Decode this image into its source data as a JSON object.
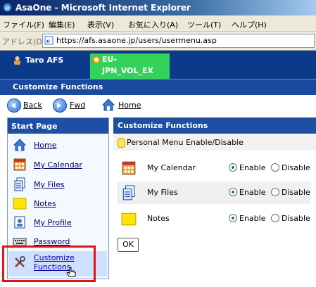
{
  "window": {
    "title": "AsaOne - Microsoft Internet Explorer"
  },
  "menubar": [
    "ファイル(F)",
    "編集(E)",
    "表示(V)",
    "お気に入り(A)",
    "ツール(T)",
    "ヘルプ(H)"
  ],
  "address": {
    "label": "アドレス(D)",
    "url": "https://afs.asaone.jp/users/usermenu.asp"
  },
  "header": {
    "user": "Taro AFS",
    "group": "EU-JPN_VOL_EX",
    "section_title": "Customize Functions"
  },
  "nav": {
    "back": "Back",
    "forward": "Fwd",
    "home": "Home"
  },
  "left_panel": {
    "title": "Start Page",
    "items": [
      "Home",
      "My Calendar",
      "My Files",
      "Notes",
      "My Profile",
      "Password",
      "Customize Functions"
    ]
  },
  "right_panel": {
    "title": "Customize Functions",
    "subtitle": "Personal Menu Enable/Disable",
    "rows": [
      {
        "name": "My Calendar",
        "enabled": true
      },
      {
        "name": "My Files",
        "enabled": true
      },
      {
        "name": "Notes",
        "enabled": true
      }
    ],
    "enable_label": "Enable",
    "disable_label": "Disable",
    "ok_label": "OK"
  },
  "colors": {
    "header_blue": "#0b3a8a",
    "panel_blue": "#1e4fa3",
    "group_green": "#33d35a",
    "highlight_red": "#e01414"
  }
}
